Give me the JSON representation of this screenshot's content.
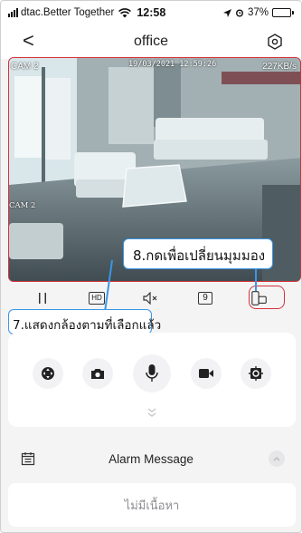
{
  "status_bar": {
    "carrier": "dtac.Better Together",
    "time": "12:58",
    "battery": "37%",
    "battery_level": 0.37,
    "icons": [
      "signal-icon",
      "wifi-icon",
      "location-icon",
      "alarm-icon",
      "battery-icon"
    ]
  },
  "nav": {
    "back": "<",
    "title": "office",
    "icons": [
      "back-icon",
      "settings-icon"
    ]
  },
  "video": {
    "camera_label": "CAM 2",
    "timestamp": "19/03/2021 12:59:26",
    "bitrate": "227KB/s",
    "side_label": "CAM 2"
  },
  "toolbar": {
    "hd_label": "HD",
    "split_label": "9",
    "icons": [
      "pause-icon",
      "hd-icon",
      "mute-icon",
      "split-screen-icon",
      "switch-view-icon"
    ]
  },
  "annotations": {
    "switch_view": "8.กดเพื่อเปลี่ยนมุมมอง",
    "camera_shown": "7.แสดงกล้องตามที่เลือกแล้ว"
  },
  "controls": {
    "icons": [
      "ptz-icon",
      "snapshot-icon",
      "microphone-icon",
      "record-icon",
      "focus-icon",
      "chevron-down-icon"
    ]
  },
  "alarm": {
    "title": "Alarm Message",
    "icons": [
      "calendar-icon",
      "chevron-up-icon"
    ]
  },
  "empty_state": "ไม่มีเนื้อหา",
  "colors": {
    "highlight": "#d8313a",
    "annotation": "#3b96e8"
  }
}
